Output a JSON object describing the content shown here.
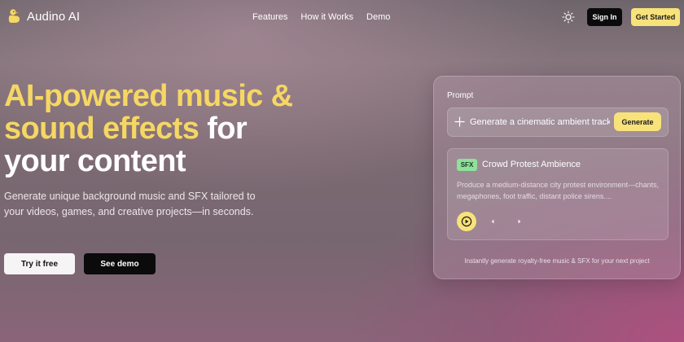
{
  "nav": {
    "brand": "Audino AI",
    "links": [
      "Features",
      "How it Works",
      "Demo"
    ],
    "theme_icon": "sun-icon",
    "signin_label": "Sign In",
    "getstarted_label": "Get Started"
  },
  "hero": {
    "title_highlight_1": "AI-powered music &",
    "title_highlight_2": "sound effects",
    "title_white_1": " for",
    "title_white_2": "your content",
    "subtitle": "Generate unique background music and SFX tailored to your videos, games, and creative projects—in seconds.",
    "try_label": "Try it free",
    "demo_label": "See demo"
  },
  "prompt_card": {
    "label": "Prompt",
    "input_value": "Generate a cinematic ambient track",
    "generate_label": "Generate",
    "result": {
      "badge": "SFX",
      "title": "Crowd Protest Ambience",
      "description": "Produce a medium-distance city protest environment—chants, megaphones, foot traffic, distant police sirens...."
    },
    "footer": "Instantly generate royalty-free music & SFX for your next project"
  },
  "colors": {
    "accent": "#f8e27a",
    "headline_highlight": "#f5d763",
    "badge_green": "#8fe09a",
    "dark_button": "#0b0b0b"
  }
}
